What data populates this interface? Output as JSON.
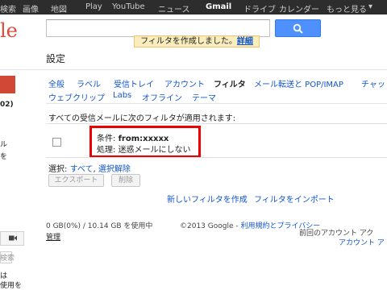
{
  "topbar": {
    "items": [
      "検索",
      "画像",
      "地図",
      "Play",
      "YouTube",
      "ニュース",
      "Gmail",
      "ドライブ",
      "カレンダー",
      "もっと見る"
    ],
    "more_arrow": "▾",
    "active_index": 6
  },
  "logo_fragment": "le",
  "notice": {
    "text": "フィルタを作成しました。",
    "link": "詳細"
  },
  "page_title": "設定",
  "left_fragments": {
    "count": "02)",
    "frag1": "ル",
    "frag2": "を",
    "search_hint": "検索",
    "bottom1": "は",
    "bottom2": "使用を"
  },
  "tabs": {
    "row1": [
      "全般",
      "ラベル",
      "受信トレイ",
      "アカウント",
      "フィルタ",
      "メール転送と POP/IMAP",
      "チャット"
    ],
    "row2": [
      "ウェブクリップ",
      "Labs",
      "オフライン",
      "テーマ"
    ],
    "active": "フィルタ"
  },
  "filters_heading": "すべての受信メールに次のフィルタが適用されます:",
  "filter": {
    "condition_label": "条件: ",
    "condition_value": "from:xxxxx",
    "action_label": "処理: ",
    "action_value": "迷惑メールにしない"
  },
  "selection": {
    "label": "選択: ",
    "all": "すべて",
    "sep": ", ",
    "none": "選択解除"
  },
  "buttons": {
    "export": "エクスポート",
    "delete": "削除"
  },
  "links": {
    "create": "新しいフィルタを作成",
    "import": "フィルタをインポート"
  },
  "footer": {
    "storage": "0 GB(0%) / 10.14 GB を使用中",
    "manage": "管理",
    "copyright": "©2013 Google - ",
    "terms": "利用規約とプライバシー",
    "activity1": "前回のアカウント アク",
    "activity2": "アカウント ア"
  },
  "colors": {
    "accent": "#4d90fe",
    "link": "#1155cc",
    "highlight_box": "#ee0000",
    "notice_bg": "#f9edbe",
    "topbar": "#2d2d2d"
  }
}
